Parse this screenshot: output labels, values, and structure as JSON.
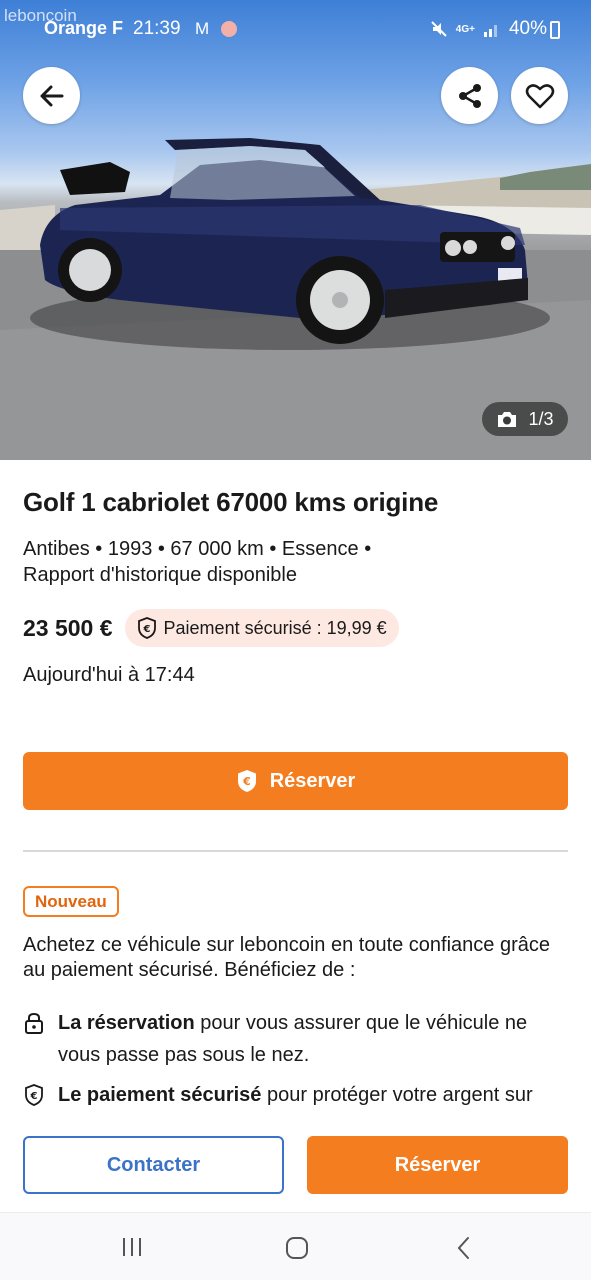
{
  "status_bar": {
    "watermark": "leboncoin",
    "carrier": "Orange F",
    "time": "21:39",
    "network": "4G+",
    "battery": "40%"
  },
  "gallery": {
    "counter": "1/3"
  },
  "listing": {
    "title": "Golf 1 cabriolet 67000 kms origine",
    "meta_line1": "Antibes • 1993 • 67 000 km • Essence •",
    "meta_line2": "Rapport d'historique disponible",
    "price": "23 500 €",
    "secure_payment": "Paiement sécurisé : 19,99 €",
    "date": "Aujourd'hui à 17:44"
  },
  "reserve_main_label": "Réserver",
  "promo": {
    "badge": "Nouveau",
    "intro": "Achetez ce véhicule sur leboncoin en toute confiance grâce au paiement sécurisé. Bénéficiez de :",
    "features": [
      {
        "bold": "La réservation",
        "text": " pour vous assurer que le véhicule ne vous passe pas sous le nez."
      },
      {
        "bold": "Le paiement sécurisé",
        "text": " pour protéger votre argent sur"
      }
    ]
  },
  "actions": {
    "contact": "Contacter",
    "reserve": "Réserver"
  },
  "colors": {
    "accent": "#f47d20",
    "link_blue": "#3b73c8",
    "pill_bg": "#fde8e2"
  }
}
